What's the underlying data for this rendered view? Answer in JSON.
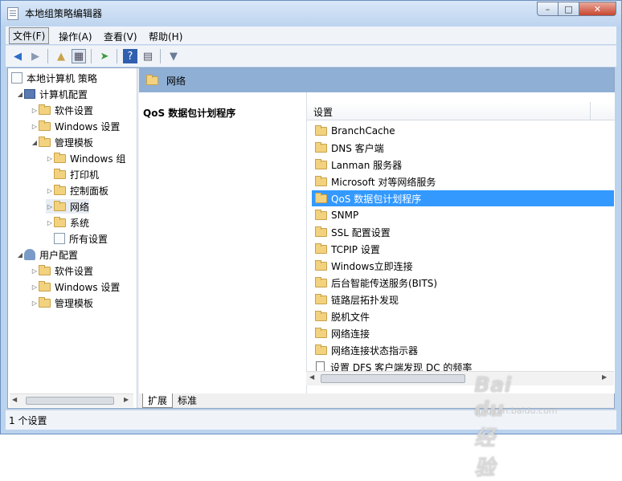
{
  "window": {
    "title": "本地组策略编辑器"
  },
  "menu": [
    "文件(F)",
    "操作(A)",
    "查看(V)",
    "帮助(H)"
  ],
  "tree": {
    "root": "本地计算机 策略",
    "computer_config": "计算机配置",
    "software_settings": "软件设置",
    "windows_settings": "Windows 设置",
    "admin_templates": "管理模板",
    "windows_components": "Windows 组",
    "printers": "打印机",
    "control_panel": "控制面板",
    "network": "网络",
    "system": "系统",
    "all_settings": "所有设置",
    "user_config": "用户配置",
    "user_software_settings": "软件设置",
    "user_windows_settings": "Windows 设置",
    "user_admin_templates": "管理模板"
  },
  "right_header": "网络",
  "description_title": "QoS 数据包计划程序",
  "list": {
    "column_header": "设置",
    "items": [
      "BranchCache",
      "DNS 客户端",
      "Lanman 服务器",
      "Microsoft 对等网络服务",
      "QoS 数据包计划程序",
      "SNMP",
      "SSL 配置设置",
      "TCPIP 设置",
      "Windows立即连接",
      "后台智能传送服务(BITS)",
      "链路层拓扑发现",
      "脱机文件",
      "网络连接",
      "网络连接状态指示器",
      "设置 DFS 客户端发现 DC 的频率"
    ]
  },
  "tabs": [
    "扩展",
    "标准"
  ],
  "status": "1 个设置",
  "watermark": {
    "brand": "Bai du 经验",
    "url": "jingyan.baidu.com"
  }
}
